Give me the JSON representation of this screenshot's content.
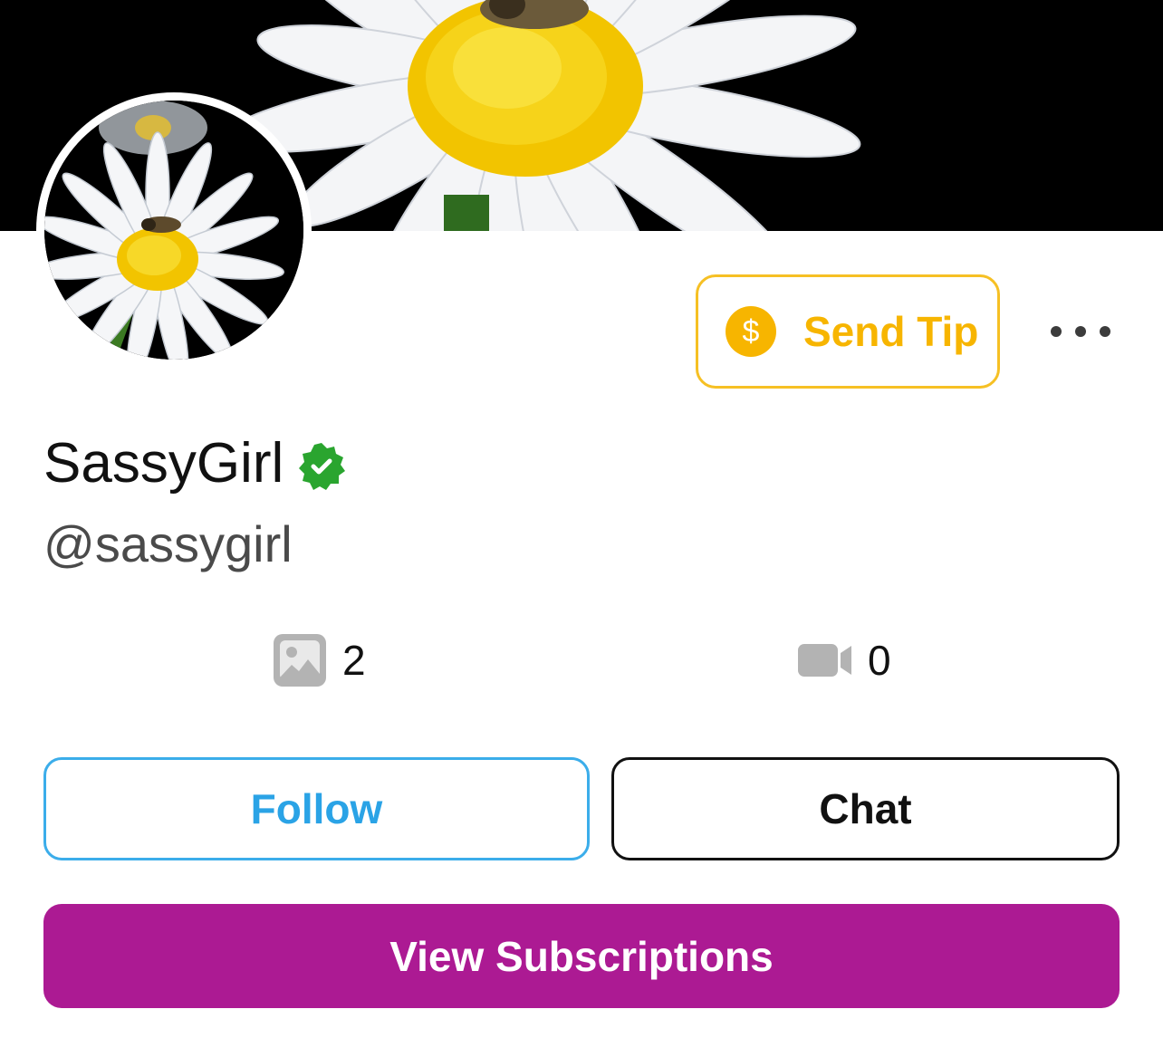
{
  "profile": {
    "display_name": "SassyGirl",
    "handle": "@sassygirl",
    "verified": true,
    "cover_image": "daisy-with-bee-photo",
    "avatar_image": "daisy-with-bee-photo"
  },
  "actions": {
    "send_tip_label": "Send Tip",
    "coin_symbol": "$",
    "more_icon": "ellipsis-icon"
  },
  "stats": {
    "photos_count": "2",
    "photos_icon": "image-icon",
    "videos_count": "0",
    "videos_icon": "video-camera-icon"
  },
  "buttons": {
    "follow_label": "Follow",
    "chat_label": "Chat",
    "subscriptions_label": "View Subscriptions"
  },
  "colors": {
    "tip_accent": "#f7b500",
    "verified_green": "#2aa52f",
    "follow_blue": "#2aa3e6",
    "subscriptions_magenta": "#ac1a93",
    "stat_icon_gray": "#b3b3b3"
  }
}
